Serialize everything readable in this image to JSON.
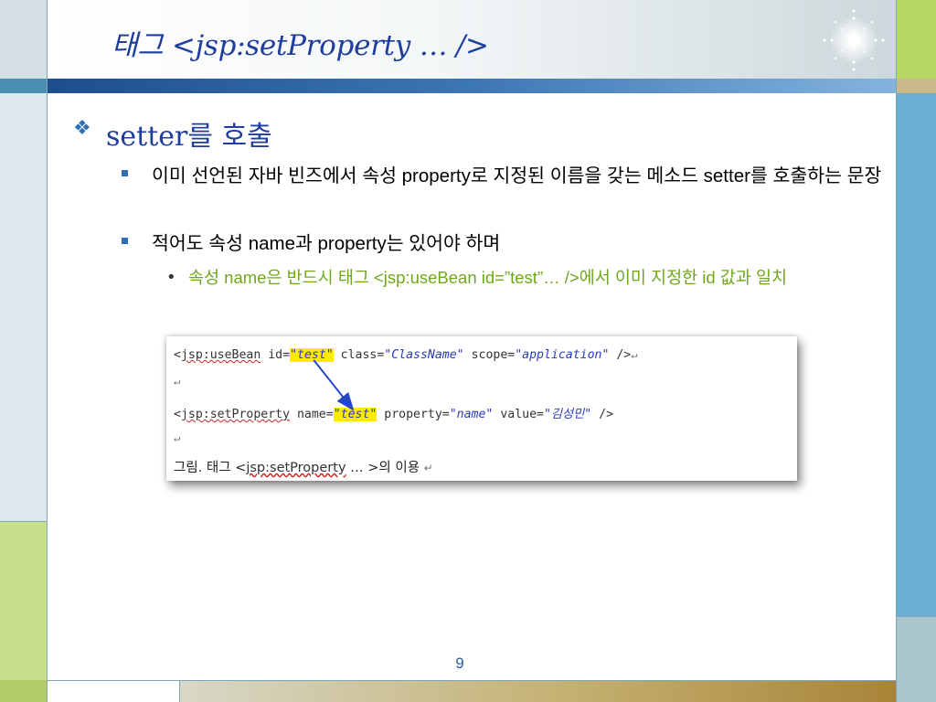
{
  "slide": {
    "title": "태그 <jsp:setProperty … />",
    "page_number": "9"
  },
  "content": {
    "level1": {
      "bullet": "❖",
      "text": "setter를 호출"
    },
    "level2": [
      {
        "text": "이미 선언된 자바 빈즈에서 속성 property로 지정된 이름을 갖는 메소드 setter를 호출하는 문장"
      },
      {
        "text": "적어도 속성 name과 property는 있어야 하며"
      }
    ],
    "level3": {
      "bullet": "•",
      "text": "속성 name은 반드시 태그 <jsp:useBean id=”test”… />에서 이미 지정한 id 값과 일치"
    }
  },
  "figure": {
    "line1": {
      "open": "<",
      "tag": "jsp:useBean",
      "id_attr": " id=",
      "id_val": "\"test\"",
      "class_attr": " class=",
      "class_val": "\"ClassName\"",
      "scope_attr": " scope=",
      "scope_val": "\"application\"",
      "close": " />",
      "return_mark": "↵"
    },
    "line2": {
      "return_mark": "↵"
    },
    "line3": {
      "open": "<",
      "tag": "jsp:setProperty",
      "name_attr": " name=",
      "name_val": "\"test\"",
      "prop_attr": " property=",
      "prop_val": "\"name\"",
      "value_attr": " value=",
      "value_val": "\"김성민\"",
      "close": " />"
    },
    "line4": {
      "return_mark": "↵"
    },
    "caption": {
      "prefix": "그림. 태그 <",
      "tag": "jsp:setProperty",
      "suffix": " … >의 이용 ",
      "return_mark": "↵"
    },
    "arrow_color": "#2446c8",
    "highlight_color": "#ffea00"
  },
  "theme": {
    "title_color": "#1e3d9c",
    "bullet_color": "#2f6fb8",
    "sub_bullet_color": "#6ea81c"
  }
}
